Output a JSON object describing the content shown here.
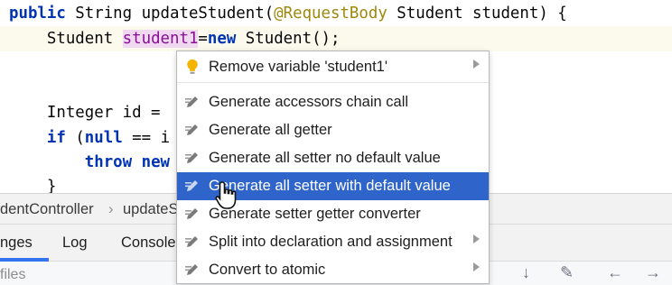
{
  "editor": {
    "line1": {
      "kw": "public",
      "type": " String updateStudent(",
      "ann": "@RequestBody",
      "rest": " Student student) {"
    },
    "line2": {
      "indent": "    ",
      "type": "Student ",
      "var": "student1",
      "eq": "=",
      "kw": "new",
      "rest": " Student();"
    },
    "line4": {
      "text": "    Integer id = "
    },
    "line5": {
      "kw": "if",
      "rest": " (",
      "kw2": "null",
      "rest2": " == i"
    },
    "line6": {
      "indent": "        ",
      "kw": "throw",
      "rest": " new"
    },
    "line7": {
      "text": "    }"
    }
  },
  "navbar": {
    "crumb1": "dentController",
    "crumb2": "updateS"
  },
  "tool_tabs": [
    "nges",
    "Log",
    "Console"
  ],
  "filesbar": {
    "label": "files"
  },
  "popup": {
    "items": [
      {
        "label": "Remove variable 'student1'",
        "icon": "bulb-icon",
        "has_submenu": true
      },
      {
        "label": "Generate accessors chain call",
        "icon": "pencil-icon",
        "has_submenu": false
      },
      {
        "label": "Generate all getter",
        "icon": "pencil-icon",
        "has_submenu": false
      },
      {
        "label": "Generate all setter no default value",
        "icon": "pencil-icon",
        "has_submenu": false
      },
      {
        "label": "Generate all setter with default value",
        "icon": "pencil-icon",
        "has_submenu": false,
        "selected": true
      },
      {
        "label": "Generate setter getter converter",
        "icon": "pencil-icon",
        "has_submenu": false
      },
      {
        "label": "Split into declaration and assignment",
        "icon": "pencil-icon",
        "has_submenu": true
      },
      {
        "label": "Convert to atomic",
        "icon": "pencil-icon",
        "has_submenu": true
      }
    ]
  },
  "colors": {
    "selection": "#2f65ca",
    "keyword": "#0033b3",
    "annotation": "#9e880d",
    "highlight": "#f0d9f0"
  }
}
